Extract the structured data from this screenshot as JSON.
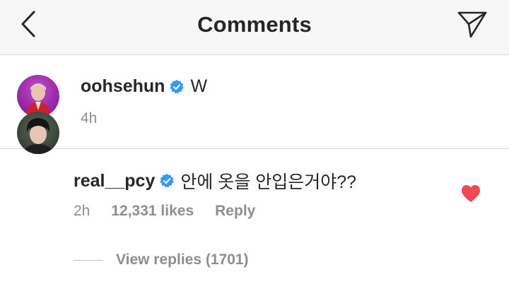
{
  "header": {
    "title": "Comments",
    "back_icon": "chevron-left-icon",
    "share_icon": "paper-plane-icon"
  },
  "caption": {
    "username": "oohsehun",
    "verified": true,
    "text": "W",
    "time": "4h",
    "avatar_color": "#9b2aa8"
  },
  "comment": {
    "username": "real__pcy",
    "verified": true,
    "text": "안에 옷을 안입은거야??",
    "time": "2h",
    "likes": "12,331 likes",
    "reply_label": "Reply",
    "liked": true,
    "heart_color": "#ed4956",
    "view_replies_label": "View replies (1701)"
  },
  "colors": {
    "verified_blue": "#3897f0",
    "secondary_text": "#8e8e8e",
    "primary_text": "#262626"
  }
}
